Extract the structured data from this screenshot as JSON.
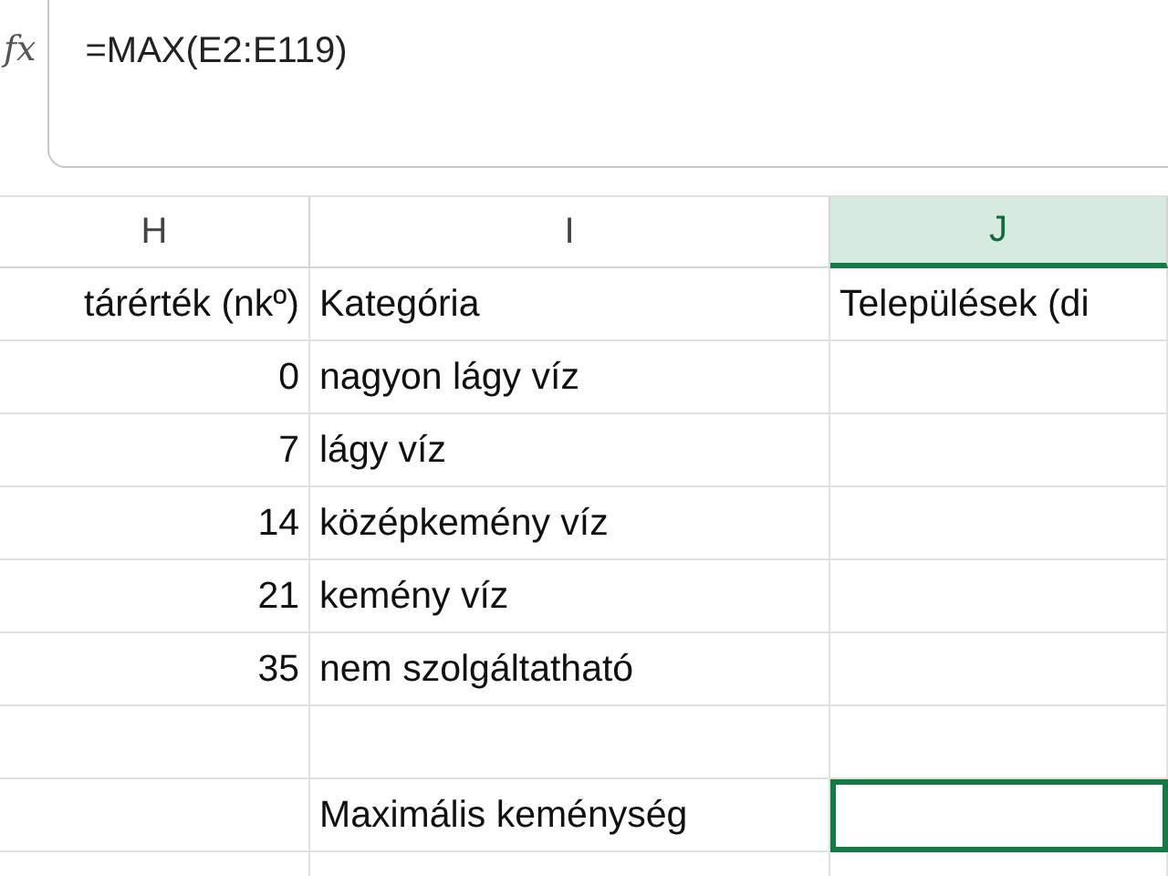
{
  "formula_bar": {
    "function_icon": "fx",
    "formula": "=MAX(E2:E119)"
  },
  "columns": [
    {
      "label": "H",
      "selected": false
    },
    {
      "label": "I",
      "selected": false
    },
    {
      "label": "J",
      "selected": true
    }
  ],
  "header_row": {
    "column_h": "tárérték (nkº)",
    "column_i": "Kategória",
    "column_j": "Települések (di"
  },
  "rows": [
    {
      "value": "0",
      "category": "nagyon lágy víz",
      "selected": false
    },
    {
      "value": "7",
      "category": "lágy víz",
      "selected": false
    },
    {
      "value": "14",
      "category": "középkemény víz",
      "selected": false
    },
    {
      "value": "21",
      "category": "kemény víz",
      "selected": false
    },
    {
      "value": "35",
      "category": "nem szolgáltatható",
      "selected": false
    },
    {
      "selected": false
    },
    {
      "category": "Maximális keménység",
      "selected": true
    },
    {
      "selected": false
    }
  ]
}
